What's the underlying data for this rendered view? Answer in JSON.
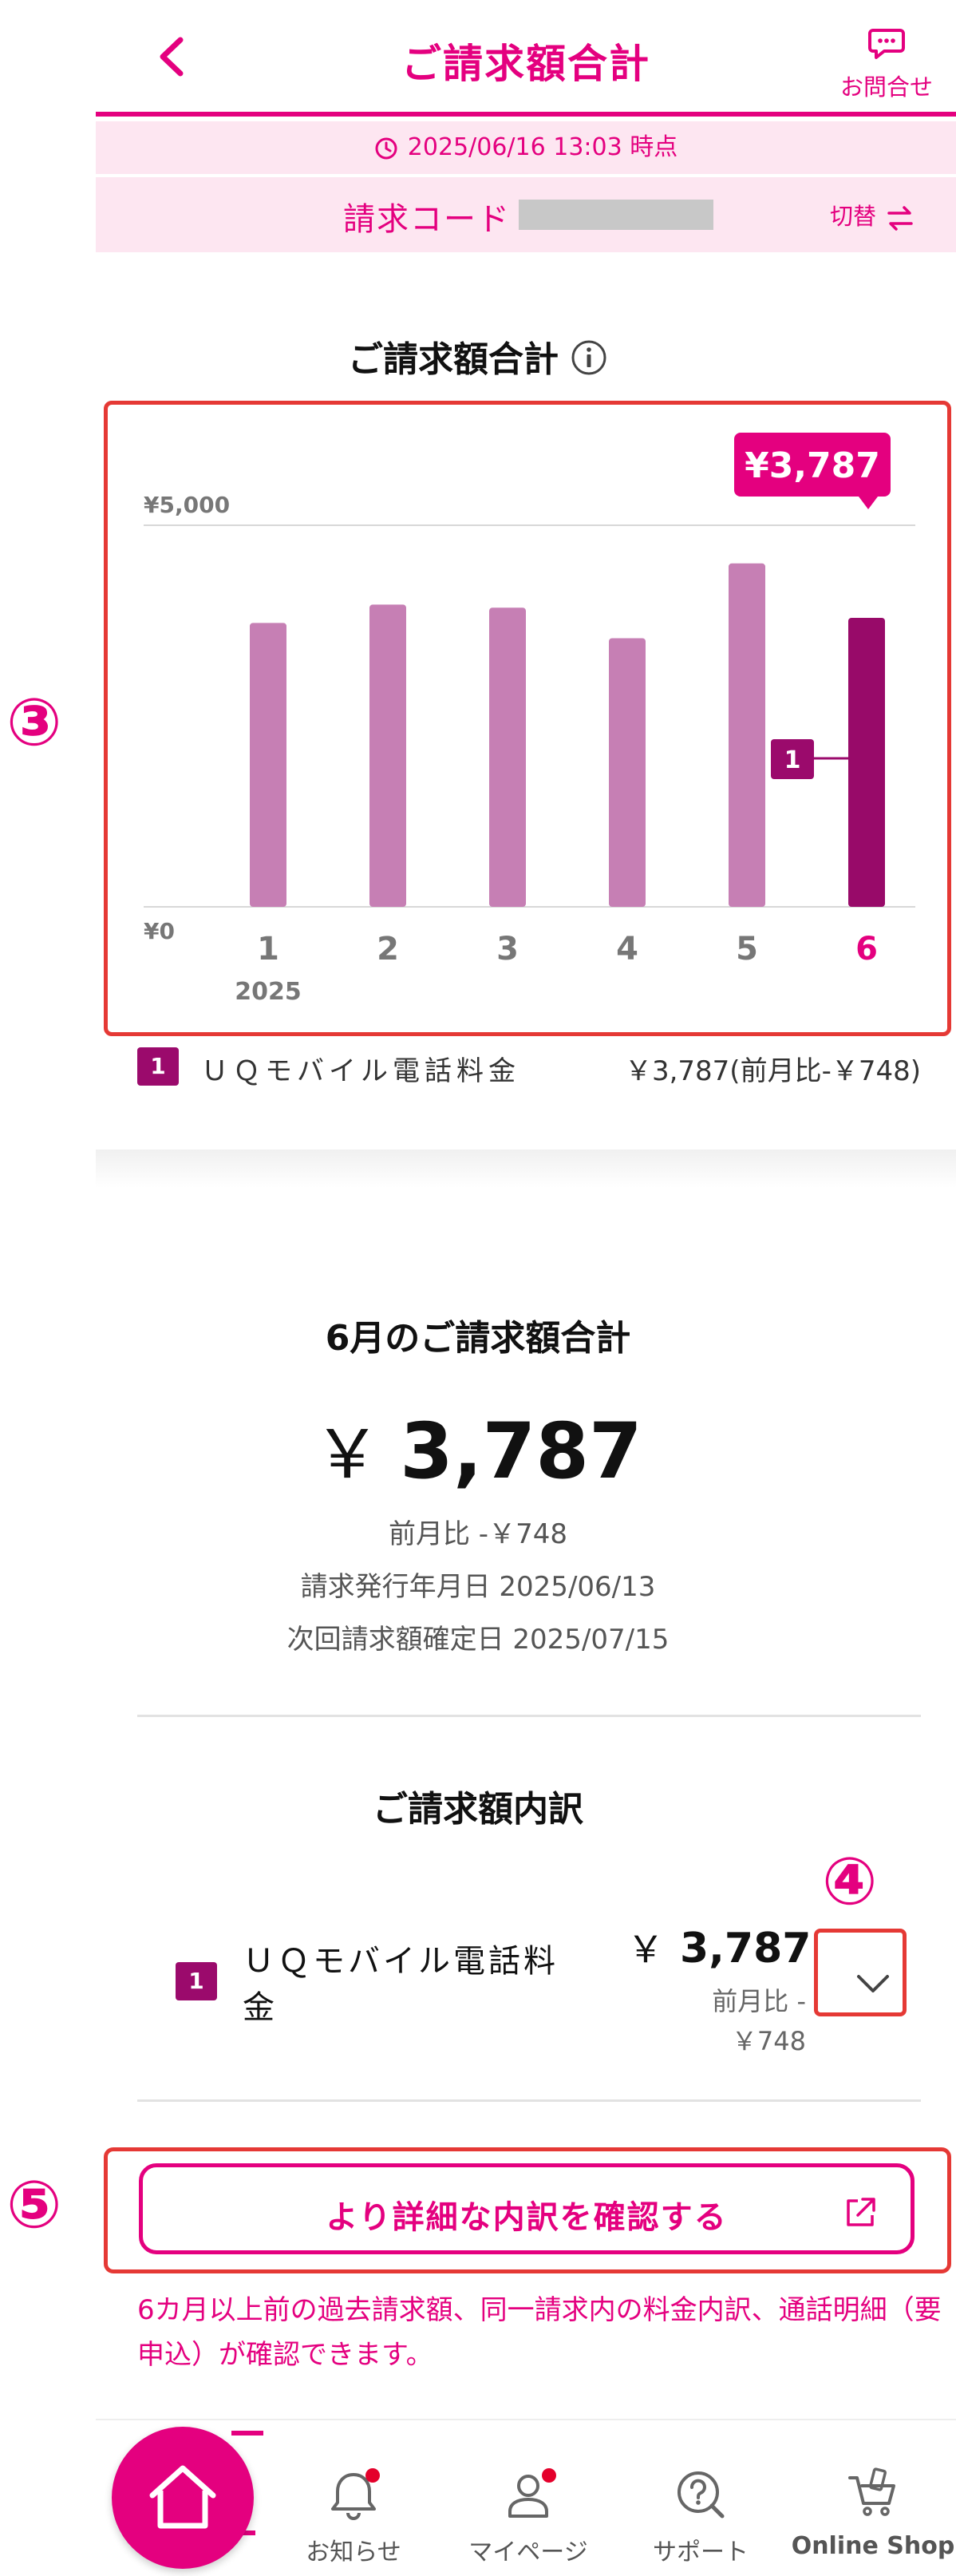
{
  "header": {
    "title": "ご請求額合計",
    "contact_label": "お問合せ",
    "timestamp": "2025/06/16 13:03 時点",
    "bill_code_label": "請求コード",
    "switch_label": "切替"
  },
  "chart_section": {
    "title": "ご請求額合計",
    "legend": {
      "badge": "1",
      "name": "ＵＱモバイル電話料金",
      "value": "￥3,787(前月比-￥748)"
    }
  },
  "chart_data": {
    "type": "bar",
    "categories": [
      "1",
      "2",
      "3",
      "4",
      "5",
      "6"
    ],
    "category_year": "2025",
    "values": [
      3720,
      3960,
      3920,
      3520,
      4500,
      3787
    ],
    "ylim": [
      0,
      5000
    ],
    "y_tick_labels": [
      "¥5,000",
      "¥0"
    ],
    "selected_index": 5,
    "selected_label": "¥3,787",
    "segment_badge": "1",
    "colors": {
      "bar": "#c67fb4",
      "selected_bar": "#980a69",
      "accent": "#e4007f"
    }
  },
  "callouts": {
    "chart": "③",
    "expand": "④",
    "detail": "⑤"
  },
  "monthly": {
    "title": "6月のご請求額合計",
    "yen": "￥",
    "amount": "3,787",
    "diff": "前月比 -￥748",
    "issue_date": "請求発行年月日 2025/06/13",
    "next_date": "次回請求額確定日 2025/07/15"
  },
  "breakdown": {
    "title": "ご請求額内訳",
    "item": {
      "badge": "1",
      "name": "ＵＱモバイル電話料金",
      "yen": "￥",
      "amount": "3,787",
      "diff": "前月比 -￥748"
    }
  },
  "detail_button": {
    "label": "より詳細な内訳を確認する",
    "note": "6カ月以上前の過去請求額、同一請求内の料金内訳、通話明細（要申込）が確認できます。"
  },
  "bottom_nav": {
    "items": [
      {
        "label": "お知らせ",
        "icon": "bell-icon"
      },
      {
        "label": "マイページ",
        "icon": "person-icon"
      },
      {
        "label": "サポート",
        "icon": "support-icon"
      },
      {
        "label": "Online Shop",
        "icon": "cart-icon"
      }
    ]
  }
}
